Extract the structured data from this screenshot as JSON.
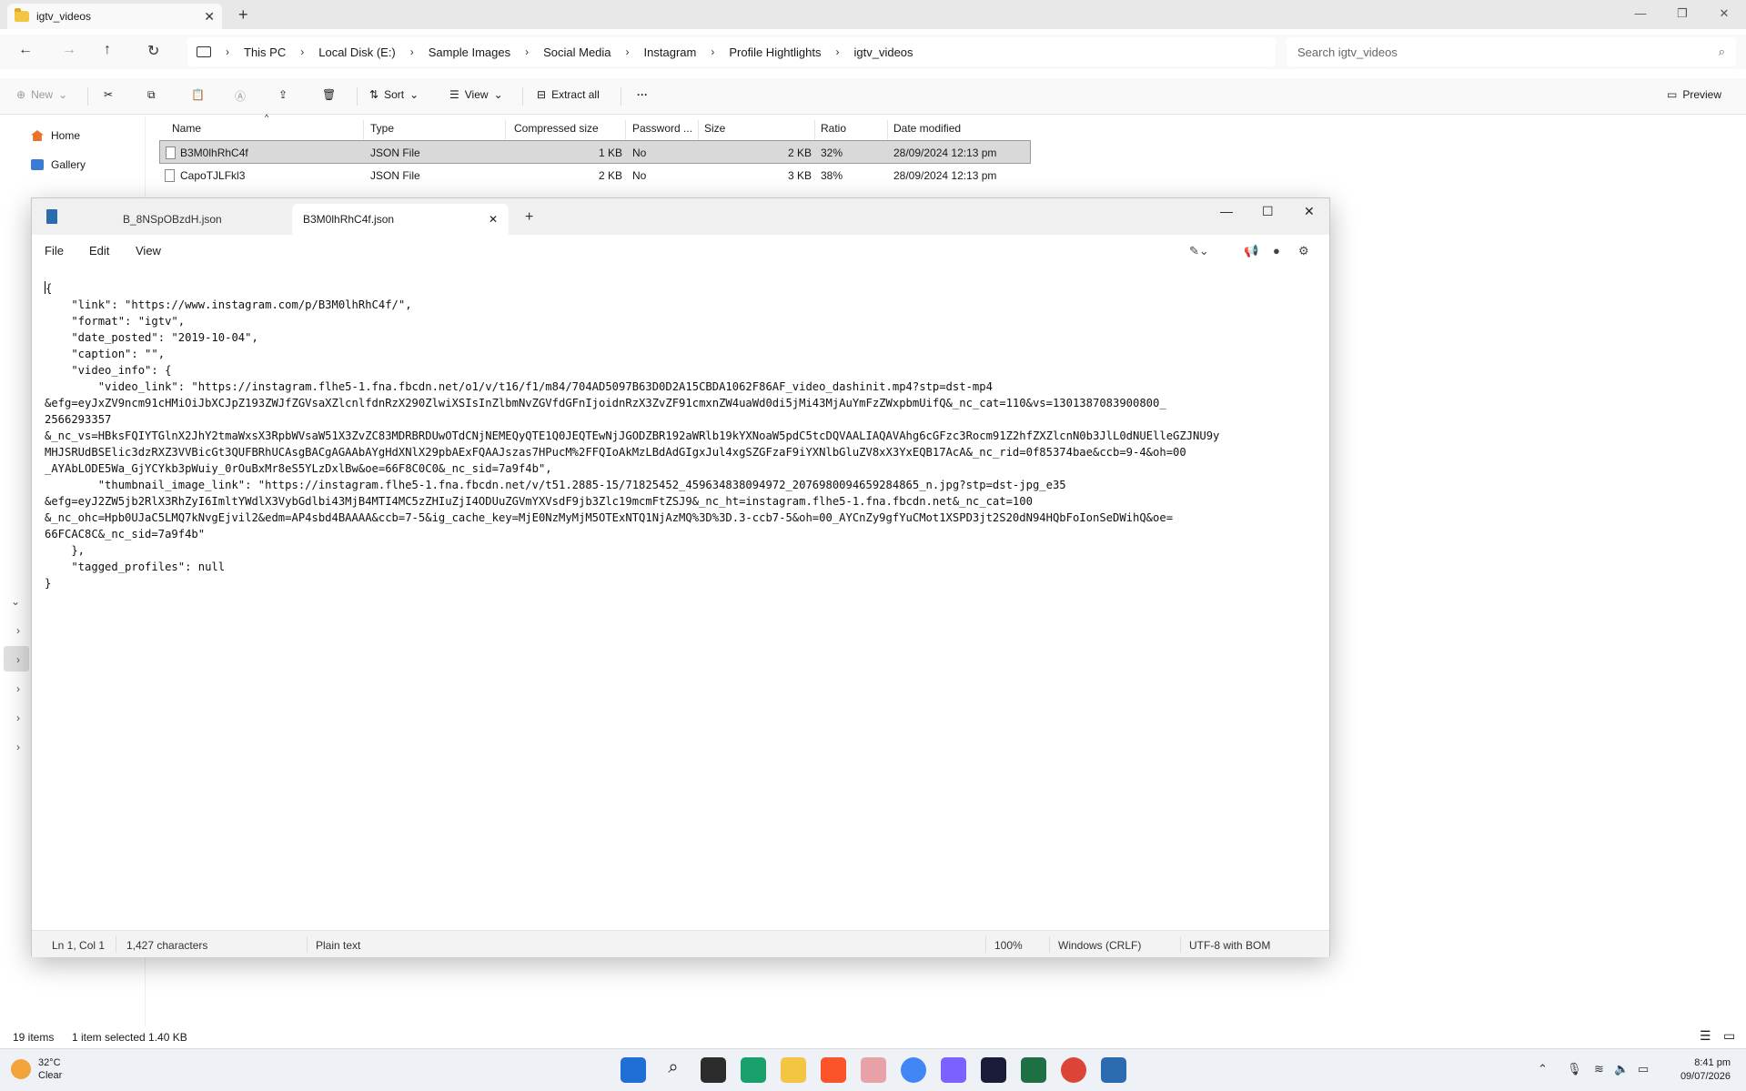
{
  "explorer": {
    "tab_title": "igtv_videos",
    "breadcrumb": [
      "This PC",
      "Local Disk (E:)",
      "Sample Images",
      "Social Media",
      "Instagram",
      "Profile Hightlights",
      "igtv_videos"
    ],
    "search_placeholder": "Search igtv_videos",
    "toolbar": {
      "new": "New",
      "sort": "Sort",
      "view": "View",
      "extract_all": "Extract all",
      "more": "···",
      "preview": "Preview"
    },
    "nav": {
      "home": "Home",
      "gallery": "Gallery"
    },
    "columns": [
      "Name",
      "Type",
      "Compressed size",
      "Password ...",
      "Size",
      "Ratio",
      "Date modified"
    ],
    "files": [
      {
        "name": "B3M0lhRhC4f",
        "type": "JSON File",
        "compressed": "1 KB",
        "password": "No",
        "size": "2 KB",
        "ratio": "32%",
        "date": "28/09/2024 12:13 pm"
      },
      {
        "name": "CapoTJLFkl3",
        "type": "JSON File",
        "compressed": "2 KB",
        "password": "No",
        "size": "3 KB",
        "ratio": "38%",
        "date": "28/09/2024 12:13 pm"
      }
    ],
    "status": {
      "count": "19 items",
      "selected": "1 item selected  1.40 KB"
    }
  },
  "notepad": {
    "tabs": [
      "B_8NSpOBzdH.json",
      "B3M0lhRhC4f.json"
    ],
    "menu": [
      "File",
      "Edit",
      "View"
    ],
    "content": "{\n    \"link\": \"https://www.instagram.com/p/B3M0lhRhC4f/\",\n    \"format\": \"igtv\",\n    \"date_posted\": \"2019-10-04\",\n    \"caption\": \"\",\n    \"video_info\": {\n        \"video_link\": \"https://instagram.flhe5-1.fna.fbcdn.net/o1/v/t16/f1/m84/704AD5097B63D0D2A15CBDA1062F86AF_video_dashinit.mp4?stp=dst-mp4\n&efg=eyJxZV9ncm91cHMiOiJbXCJpZ193ZWJfZGVsaXZlcnlfdnRzX290ZlwiXSIsInZlbmNvZGVfdGFnIjoidnRzX3ZvZF91cmxnZW4uaWd0di5jMi43MjAuYmFzZWxpbmUifQ&_nc_cat=110&vs=1301387083900800_\n2566293357\n&_nc_vs=HBksFQIYTGlnX2JhY2tmaWxsX3RpbWVsaW51X3ZvZC83MDRBRDUwOTdCNjNEMEQyQTE1Q0JEQTEwNjJGODZBR192aWRlb19kYXNoaW5pdC5tcDQVAALIAQAVAhg6cGFzc3Rocm91Z2hfZXZlcnN0b3JlL0dNUElleGZJNU9y\nMHJSRUdBSElic3dzRXZ3VVBicGt3QUFBRhUCAsgBACgAGAAbAYgHdXNlX29pbAExFQAAJszas7HPucM%2FFQIoAkMzLBdAdGIgxJul4xgSZGFzaF9iYXNlbGluZV8xX3YxEQB17AcA&_nc_rid=0f85374bae&ccb=9-4&oh=00\n_AYAbLODE5Wa_GjYCYkb3pWuiy_0rOuBxMr8eS5YLzDxlBw&oe=66F8C0C0&_nc_sid=7a9f4b\",\n        \"thumbnail_image_link\": \"https://instagram.flhe5-1.fna.fbcdn.net/v/t51.2885-15/71825452_459634838094972_2076980094659284865_n.jpg?stp=dst-jpg_e35\n&efg=eyJ2ZW5jb2RlX3RhZyI6ImltYWdlX3VybGdlbi43MjB4MTI4MC5zZHIuZjI4ODUuZGVmYXVsdF9jb3Zlc19mcmFtZSJ9&_nc_ht=instagram.flhe5-1.fna.fbcdn.net&_nc_cat=100\n&_nc_ohc=Hpb0UJaC5LMQ7kNvgEjvil2&edm=AP4sbd4BAAAA&ccb=7-5&ig_cache_key=MjE0NzMyMjM5OTExNTQ1NjAzMQ%3D%3D.3-ccb7-5&oh=00_AYCnZy9gfYuCMot1XSPD3jt2S20dN94HQbFoIonSeDWihQ&oe=\n66FCAC8C&_nc_sid=7a9f4b\"\n    },\n    \"tagged_profiles\": null\n}",
    "status": {
      "position": "Ln 1, Col 1",
      "chars": "1,427 characters",
      "format": "Plain text",
      "zoom": "100%",
      "eol": "Windows (CRLF)",
      "encoding": "UTF-8 with BOM"
    }
  },
  "taskbar": {
    "weather_temp": "32°C",
    "weather_desc": "Clear",
    "time": "8:41 pm",
    "date": "09/07/2026"
  }
}
